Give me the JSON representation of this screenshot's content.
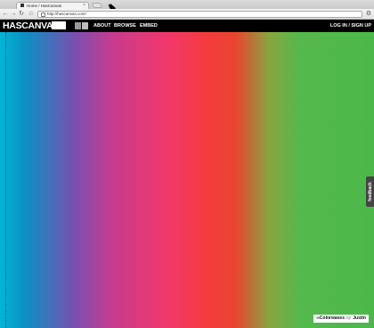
{
  "browser": {
    "tab_title": "Home / HasCanvas",
    "tab_close": "×",
    "url": "http://hascanvas.com/",
    "back_glyph": "←",
    "forward_glyph": "→",
    "reload_glyph": "↻",
    "star_glyph": "☆",
    "wrench_glyph": "⚙"
  },
  "site": {
    "logo_text": "HASCANVAS",
    "logo_slash": "/",
    "nav": [
      "ABOUT",
      "BROWSE",
      "EMBED"
    ],
    "auth_label": "LOG IN / SIGN UP"
  },
  "feedback_label": "feedback",
  "credit": {
    "title": "∞Colorwaves",
    "by": "by",
    "author": "Justin"
  },
  "colors": {
    "header_bg": "#000000",
    "gradient": [
      "#00b6d6",
      "#0e8ec4",
      "#7a4fb1",
      "#c73b8e",
      "#f2386a",
      "#f43b3e",
      "#e9452f",
      "#88a540",
      "#55b84c",
      "#4cb84a"
    ]
  }
}
